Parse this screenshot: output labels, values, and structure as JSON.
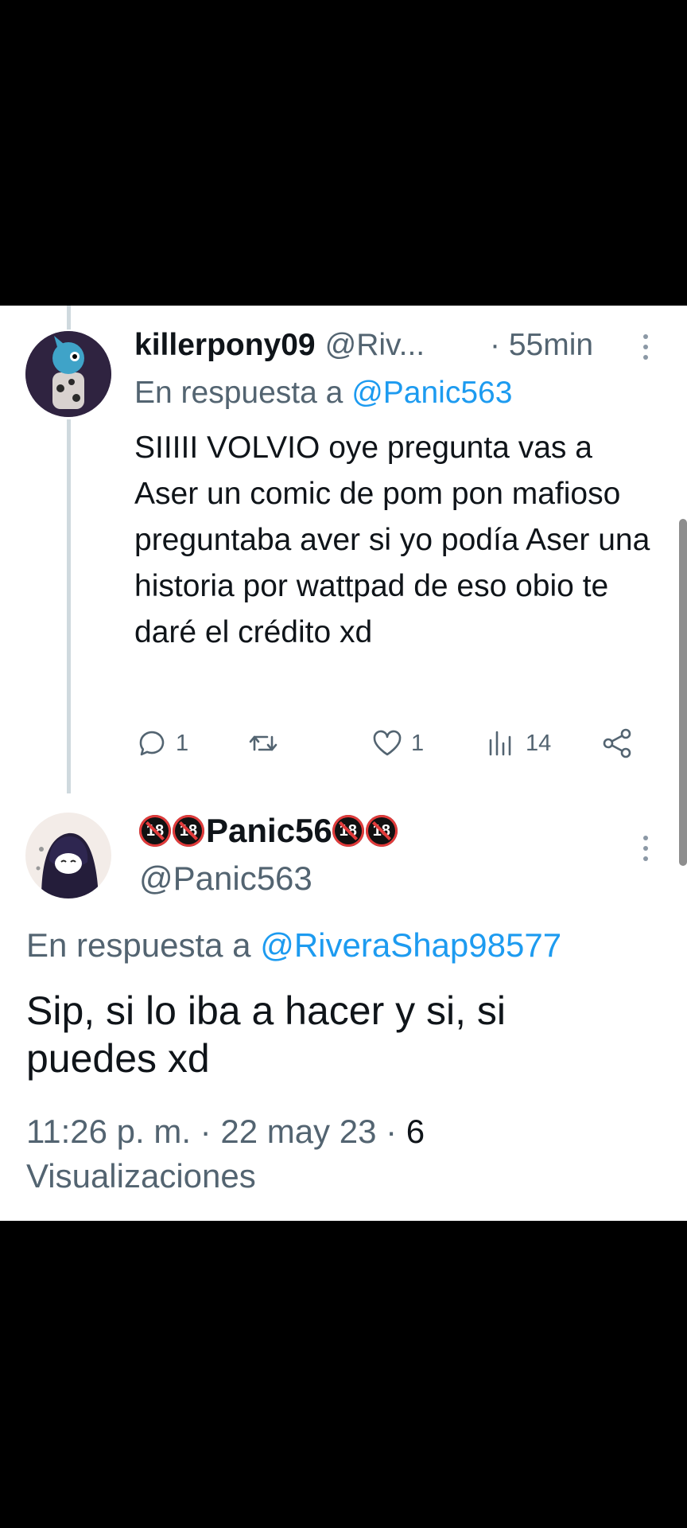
{
  "reply_tweet": {
    "display_name": "killerpony09",
    "handle": "@Riv...",
    "time": "· 55min",
    "replying_label": "En respuesta a",
    "replying_to": "@Panic563",
    "body": "SIIIII VOLVIO oye pregunta vas a Aser un comic de pom pon mafioso preguntaba aver si yo podía Aser una historia por wattpad de eso obio te daré el crédito xd",
    "actions": {
      "reply_count": "1",
      "retweet_count": "",
      "like_count": "1",
      "views_count": "14"
    },
    "icons": [
      "reply-icon",
      "retweet-icon",
      "like-icon",
      "views-icon",
      "share-icon",
      "more-icon"
    ]
  },
  "main_tweet": {
    "display_name_badge_left_1": "18",
    "display_name_badge_left_2": "18",
    "display_name": "Panic56",
    "display_name_badge_right_1": "18",
    "display_name_badge_right_2": "18",
    "handle": "@Panic563",
    "replying_label": "En respuesta a",
    "replying_to": "@RiveraShap98577",
    "body": "Sip, si lo iba a hacer y si, si puedes xd",
    "timestamp": "11:26 p. m. · 22 may 23 ·",
    "views_count": "6",
    "views_label": "Visualizaciones"
  },
  "colors": {
    "background": "#000000",
    "panel": "#ffffff",
    "text": "#0f1419",
    "muted": "#536471",
    "link": "#1d9bf0"
  }
}
